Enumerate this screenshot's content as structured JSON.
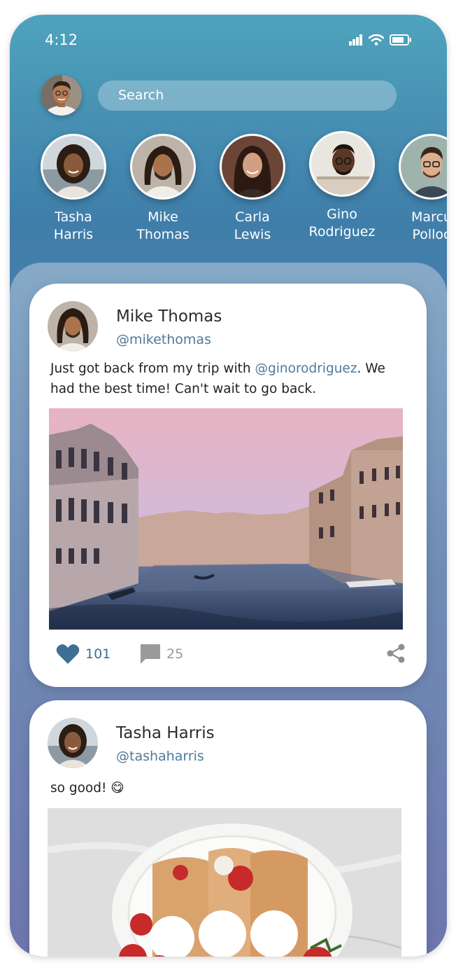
{
  "status_bar": {
    "time": "4:12"
  },
  "search": {
    "placeholder": "Search"
  },
  "stories": [
    {
      "line1": "Tasha",
      "line2": "Harris"
    },
    {
      "line1": "Mike",
      "line2": "Thomas"
    },
    {
      "line1": "Carla",
      "line2": "Lewis"
    },
    {
      "line1": "Gino",
      "line2": "Rodriguez"
    },
    {
      "line1": "Marcu",
      "line2": "Polloc"
    }
  ],
  "posts": [
    {
      "author": "Mike Thomas",
      "handle": "@mikethomas",
      "text_before": "Just got back from my trip with ",
      "mention": "@ginorodriguez",
      "text_after": ". We had the best time! Can't wait to go back.",
      "likes": "101",
      "comments": "25"
    },
    {
      "author": "Tasha Harris",
      "handle": "@tashaharris",
      "text": "so good! 😋"
    }
  ],
  "colors": {
    "accent": "#3e6f94",
    "handle": "#4f7a9a",
    "gradient_top": "#4fa3bd",
    "gradient_bottom": "#7468a8"
  }
}
